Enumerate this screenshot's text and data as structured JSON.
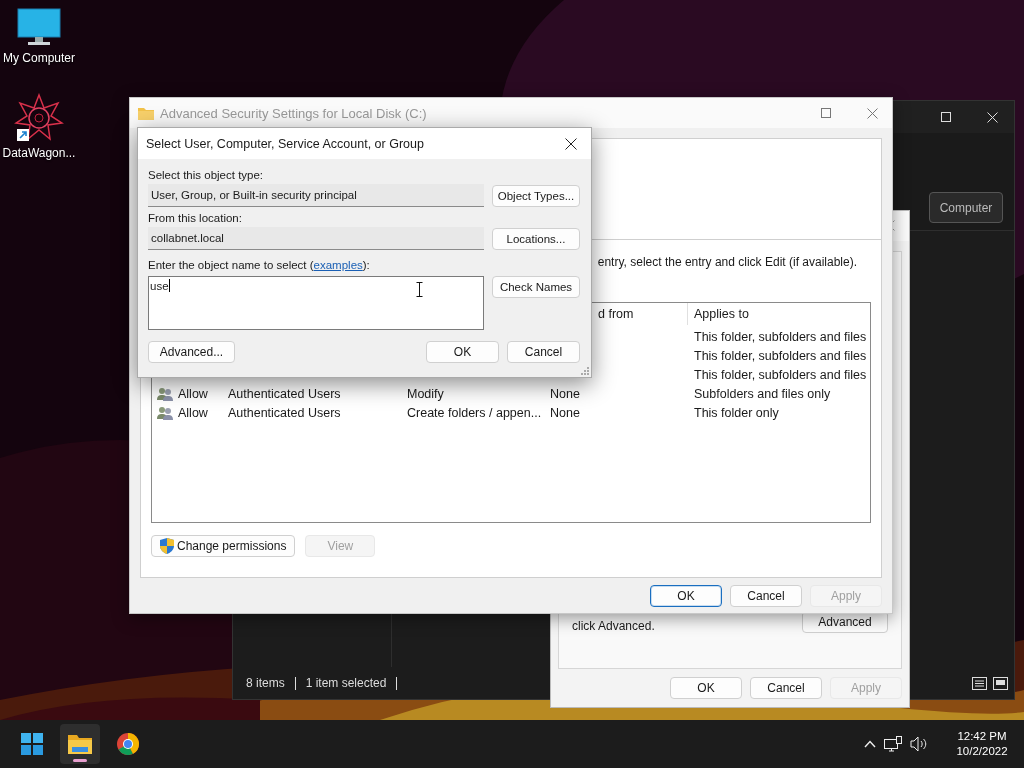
{
  "desktop": {
    "icons": [
      {
        "label": "My Computer",
        "kind": "monitor"
      },
      {
        "label": "DataWagon...",
        "kind": "app-shortcut"
      }
    ]
  },
  "explorer": {
    "search_text": "Computer",
    "status": [
      "8 items",
      "1 item selected"
    ]
  },
  "properties": {
    "text": "click Advanced.",
    "advanced_button": "Advanced",
    "buttons": [
      {
        "label": "OK",
        "disabled": false
      },
      {
        "label": "Cancel",
        "disabled": false
      },
      {
        "label": "Apply",
        "disabled": true
      }
    ]
  },
  "advanced": {
    "title": "Advanced Security Settings for Local Disk (C:)",
    "instruction": "entry, select the entry and click Edit (if available).",
    "columns": [
      "d from",
      "Applies to"
    ],
    "rows": [
      {
        "applies_to": "This folder, subfolders and files"
      },
      {
        "applies_to": "This folder, subfolders and files"
      },
      {
        "applies_to": "This folder, subfolders and files"
      },
      {
        "type": "Allow",
        "principal": "Authenticated Users",
        "access": "Modify",
        "inherited": "None",
        "applies_to": "Subfolders and files only"
      },
      {
        "type": "Allow",
        "principal": "Authenticated Users",
        "access": "Create folders / appen...",
        "inherited": "None",
        "applies_to": "This folder only"
      }
    ],
    "change_permissions": "Change permissions",
    "view": {
      "label": "View",
      "disabled": true
    },
    "buttons": [
      {
        "label": "OK",
        "disabled": false,
        "default": true
      },
      {
        "label": "Cancel",
        "disabled": false,
        "default": false
      },
      {
        "label": "Apply",
        "disabled": true,
        "default": false
      }
    ]
  },
  "dialog": {
    "title": "Select User, Computer, Service Account, or Group",
    "type_label": "Select this object type:",
    "type_value": "User, Group, or Built-in security principal",
    "type_button": "Object Types...",
    "location_label": "From this location:",
    "location_value": "collabnet.local",
    "location_button": "Locations...",
    "name_prompt": {
      "before": "Enter the object name to select (",
      "link": "examples",
      "after": "):"
    },
    "name_value": "use",
    "check_button": "Check Names",
    "advanced_button": "Advanced...",
    "ok_button": "OK",
    "cancel_button": "Cancel"
  },
  "taskbar": {
    "apps": [
      {
        "kind": "start",
        "selected": false
      },
      {
        "kind": "explorer",
        "selected": true
      },
      {
        "kind": "chrome",
        "selected": false
      }
    ],
    "time": "12:42 PM",
    "date": "10/2/2022"
  }
}
